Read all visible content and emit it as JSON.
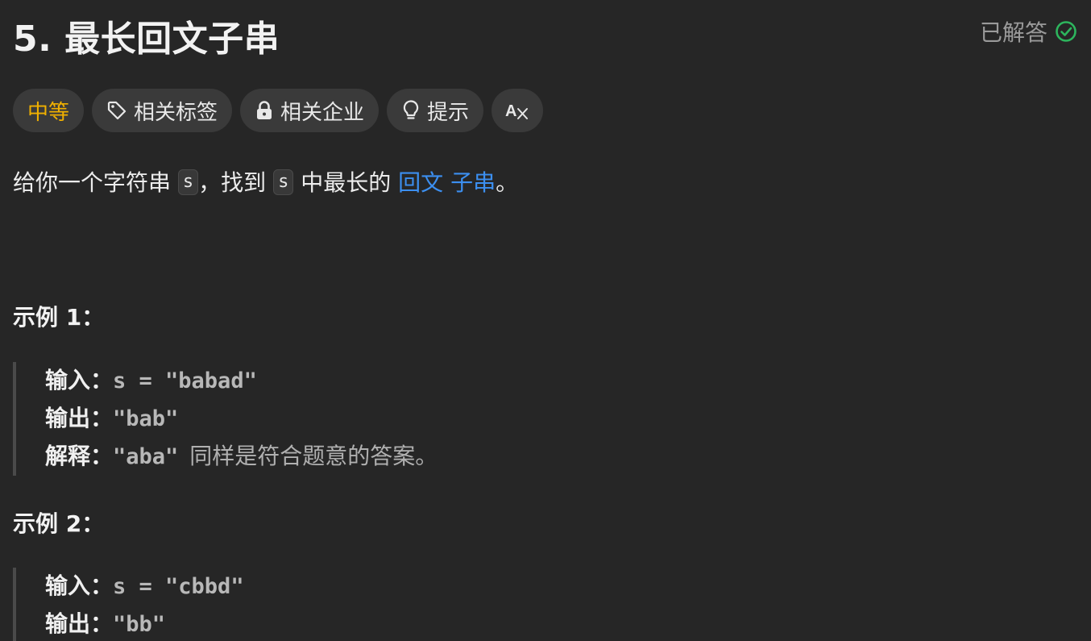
{
  "problem": {
    "title": "5. 最长回文子串",
    "status": "已解答"
  },
  "tags": {
    "difficulty": "中等",
    "related_tags": "相关标签",
    "related_companies": "相关企业",
    "hint": "提示",
    "font_toggle": "Aあ"
  },
  "description": {
    "part1": "给你一个字符串",
    "code1": "s",
    "part2": "，找到",
    "code2": "s",
    "part3": "中最长的",
    "link1": "回文",
    "link2": "子串",
    "part4": "。"
  },
  "examples": [
    {
      "heading": "示例 1：",
      "input_label": "输入：",
      "input_value": "s = \"babad\"",
      "output_label": "输出：",
      "output_value": "\"bab\"",
      "explain_label": "解释：",
      "explain_value": "\"aba\"",
      "explain_note": "同样是符合题意的答案。"
    },
    {
      "heading": "示例 2：",
      "input_label": "输入：",
      "input_value": "s = \"cbbd\"",
      "output_label": "输出：",
      "output_value": "\"bb\""
    }
  ],
  "colors": {
    "background": "#262626",
    "difficulty_medium": "#f0b000",
    "link": "#3c8ff0",
    "solved_check": "#2db55d"
  },
  "icons": {
    "tag": "tag-icon",
    "lock": "lock-icon",
    "hint": "lightbulb-icon",
    "font": "translate-icon",
    "solved": "check-circle-icon"
  }
}
